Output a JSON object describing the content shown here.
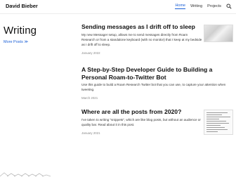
{
  "header": {
    "site_title": "David Bieber",
    "nav": [
      {
        "label": "Home",
        "active": true
      },
      {
        "label": "Writing",
        "active": false
      },
      {
        "label": "Projects",
        "active": false
      }
    ],
    "search_icon": "search-icon"
  },
  "sidebar": {
    "heading": "Writing",
    "more_posts": "More Posts ≫"
  },
  "posts": [
    {
      "title": "Sending messages as I drift off to sleep",
      "excerpt": "My new Messager setup, allows me to send messages directly from Roam Research or from a standalone keyboard (with no monitor) that I keep at my bedside as I drift off to sleep.",
      "date": "January 2022"
    },
    {
      "title": "A Step-by-Step Developer Guide to Building a Personal Roam-to-Twitter Bot",
      "excerpt": "Use this guide to build a Roam Research Twitter bot that you can use, to capture your attention when tweeting.",
      "date": "March 2021"
    },
    {
      "title": "Where are all the posts from 2020?",
      "excerpt": "I've taken to writing \"snippets\", which are like blog posts, but without an audience or quality bar. Read about it in this post.",
      "date": "January 2021"
    }
  ],
  "colors": {
    "accent": "#1a5fd6",
    "text": "#111111",
    "muted": "#888888"
  }
}
